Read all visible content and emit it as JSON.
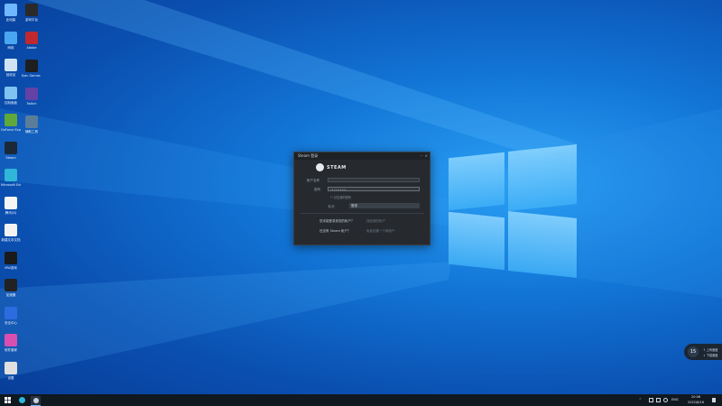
{
  "desktop": {
    "icons_left": [
      {
        "label": "此电脑",
        "icon": "computer-icon",
        "color": "#6fb7ff"
      },
      {
        "label": "网络",
        "icon": "network-icon",
        "color": "#4aa6f0"
      },
      {
        "label": "回收站",
        "icon": "recycle-bin-icon",
        "color": "#cfe3f5"
      },
      {
        "label": "控制面板",
        "icon": "control-panel-icon",
        "color": "#7fc3f0"
      },
      {
        "label": "GeForce Experience",
        "icon": "nvidia-icon",
        "color": "#5fa83b"
      },
      {
        "label": "Steam",
        "icon": "steam-icon",
        "color": "#1b2838"
      },
      {
        "label": "Microsoft Edge",
        "icon": "edge-icon",
        "color": "#2fb6d8"
      },
      {
        "label": "腾讯QQ",
        "icon": "qq-icon",
        "color": "#f5f5f5"
      },
      {
        "label": "新建文本文档",
        "icon": "text-document-icon",
        "color": "#f2f2f2"
      },
      {
        "label": "MW游戏",
        "icon": "game-icon",
        "color": "#1a1a1a"
      },
      {
        "label": "加速器",
        "icon": "accelerator-icon",
        "color": "#222"
      },
      {
        "label": "安全中心",
        "icon": "shield-icon",
        "color": "#2d6be0"
      },
      {
        "label": "软件管家",
        "icon": "app-store-icon",
        "color": "#d84fb0"
      },
      {
        "label": "设置",
        "icon": "settings-icon",
        "color": "#e0e0e0"
      }
    ],
    "icons_right": [
      {
        "label": "游戏平台",
        "icon": "game-platform-icon",
        "color": "#2a2a2a"
      },
      {
        "label": "Adobe",
        "icon": "adobe-icon",
        "color": "#c0282f"
      },
      {
        "label": "Epic Games Launcher",
        "icon": "epic-games-icon",
        "color": "#1e1e1e"
      },
      {
        "label": "Twitch",
        "icon": "twitch-icon",
        "color": "#6441a5"
      },
      {
        "label": "辅助工具",
        "icon": "tool-icon",
        "color": "#5a7d9a"
      }
    ]
  },
  "steam_dialog": {
    "title": "Steam 登录",
    "brand": "STEAM",
    "username_label": "帐户名称",
    "username_value": "",
    "password_label": "密码",
    "password_value": "••••••••••",
    "remember_label": "记住我的密码",
    "cancel_label": "取消",
    "login_label": "登录",
    "q1": "您未能登录到您的帐户？",
    "a1": "找回我的帐户",
    "q2": "还没有 Steam 帐户？",
    "a2": "免费创建一个新帐户"
  },
  "notification_bubble": {
    "number": "15",
    "line1": "↑ 上传速度",
    "line2": "↓ 下载速度"
  },
  "taskbar": {
    "lang": "ENG",
    "time": "20:06",
    "date": "2022/8/16"
  },
  "colors": {
    "taskbar": "#101820",
    "dialog_bg": "#262a2f",
    "accent": "#1275d6"
  }
}
